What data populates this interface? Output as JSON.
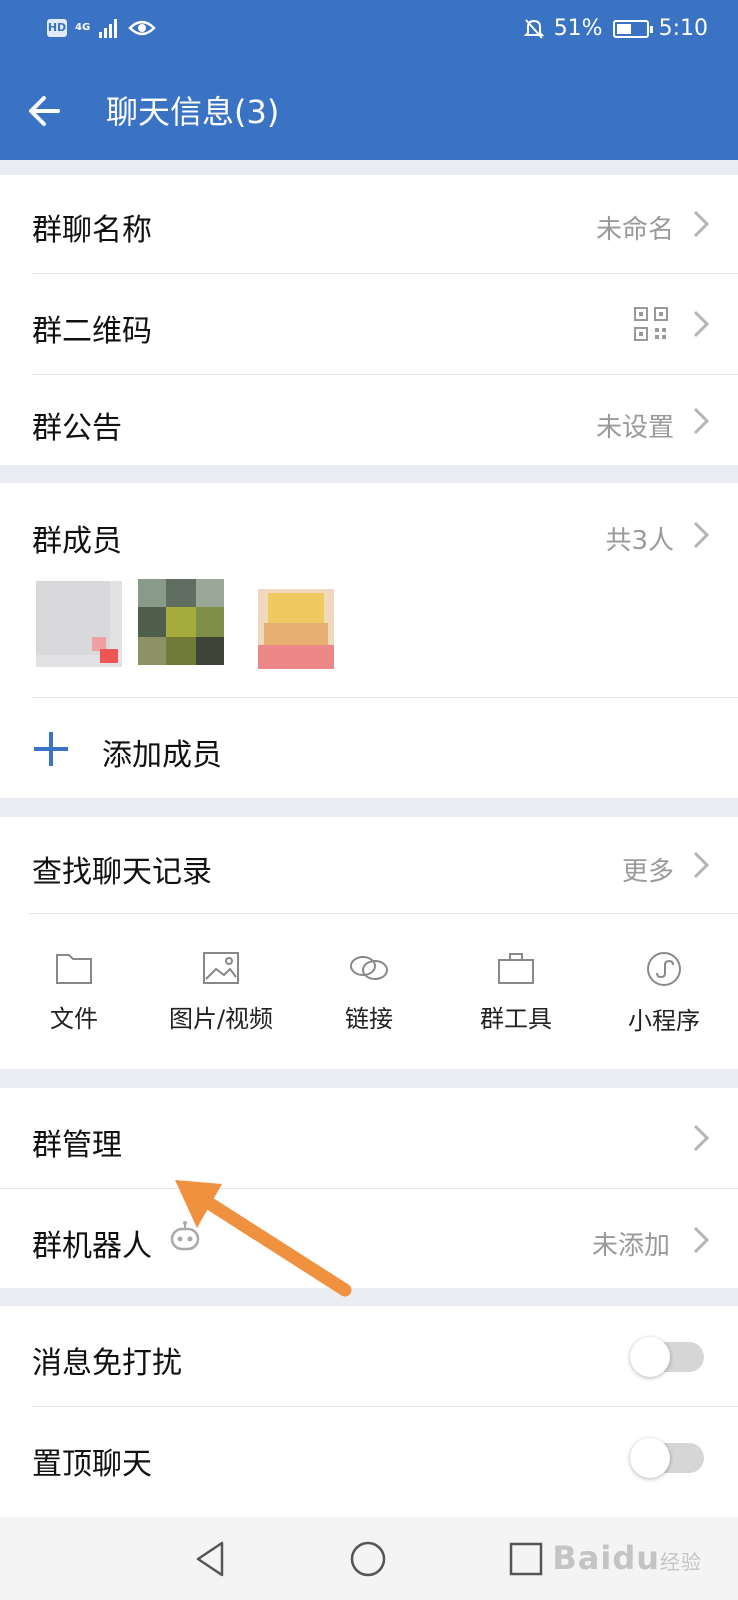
{
  "status_bar": {
    "hd": "HD",
    "network": "4G",
    "battery_percent_text": "51%",
    "battery_level": 0.51,
    "time": "5:10"
  },
  "header": {
    "title": "聊天信息(3)"
  },
  "group_info": {
    "name_label": "群聊名称",
    "name_value": "未命名",
    "qrcode_label": "群二维码",
    "notice_label": "群公告",
    "notice_value": "未设置"
  },
  "members": {
    "label": "群成员",
    "count": "共3人",
    "add_label": "添加成员"
  },
  "history": {
    "label": "查找聊天记录",
    "more": "更多",
    "shortcuts": [
      {
        "label": "文件",
        "icon": "folder-icon"
      },
      {
        "label": "图片/视频",
        "icon": "image-icon"
      },
      {
        "label": "链接",
        "icon": "link-icon"
      },
      {
        "label": "群工具",
        "icon": "briefcase-icon"
      },
      {
        "label": "小程序",
        "icon": "mini-program-icon"
      }
    ]
  },
  "manage": {
    "manage_label": "群管理",
    "robot_label": "群机器人",
    "robot_value": "未添加"
  },
  "settings": {
    "mute_label": "消息免打扰",
    "mute_on": false,
    "pin_label": "置顶聊天",
    "pin_on": false
  },
  "watermark": {
    "text": "Baidu",
    "suffix": "经验"
  },
  "colors": {
    "header": "#3a72c4",
    "accent": "#3a72c4",
    "arrow": "#f0913f"
  }
}
